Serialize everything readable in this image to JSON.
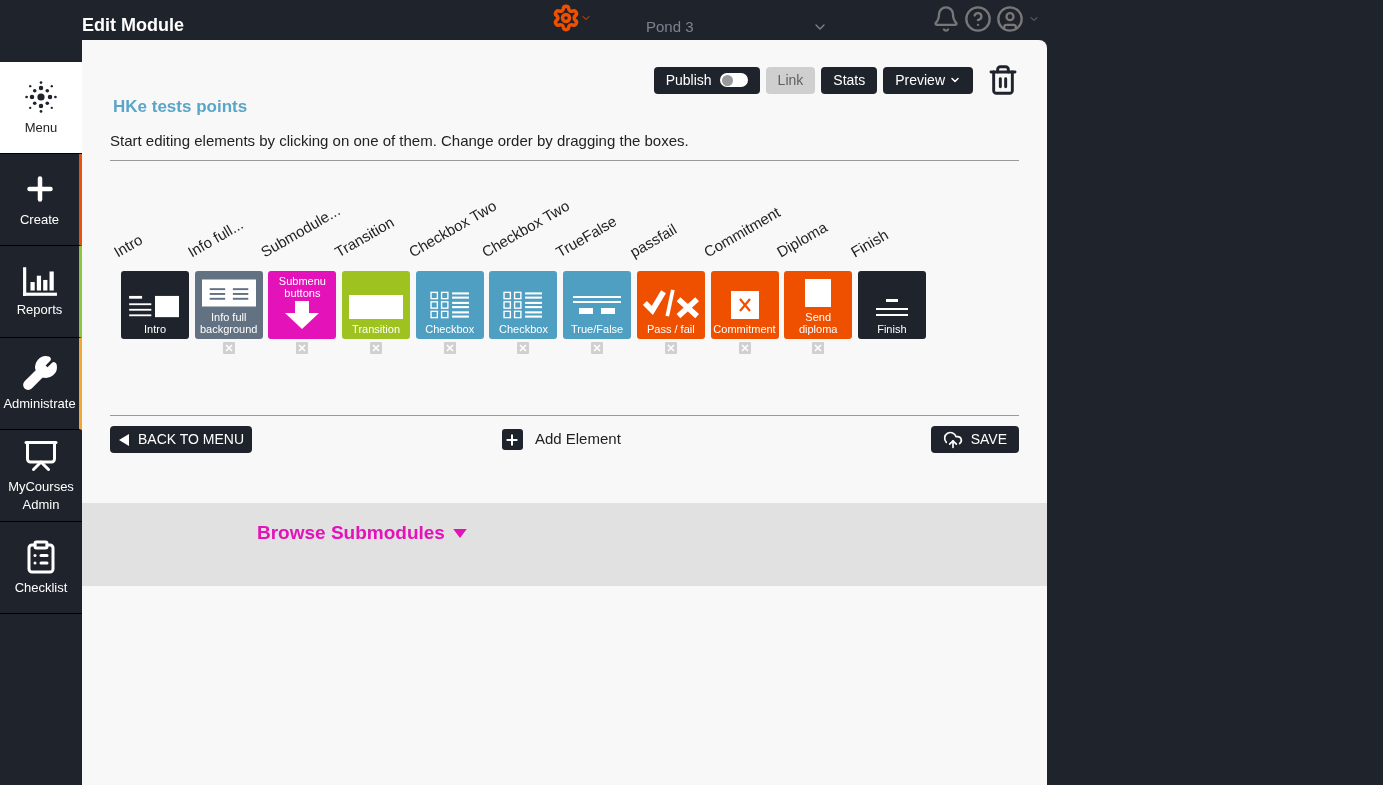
{
  "header": {
    "title": "Edit Module",
    "organization": "Pond 3"
  },
  "sidebar": {
    "items": [
      {
        "label": "Menu",
        "selected": true
      },
      {
        "label": "Create",
        "selected": false,
        "color": "#e8500c"
      },
      {
        "label": "Reports",
        "selected": false,
        "color": "#8cc63f"
      },
      {
        "label": "Administrate",
        "selected": false,
        "color": "#f0a830"
      },
      {
        "label": "MyCourses Admin",
        "selected": false
      },
      {
        "label": "Checklist",
        "selected": false
      }
    ]
  },
  "toolbar": {
    "publish": {
      "label": "Publish",
      "on": false
    },
    "link": {
      "label": "Link",
      "disabled": true
    },
    "stats": "Stats",
    "preview": "Preview"
  },
  "module": {
    "title": "HKe tests points",
    "instructions": "Start editing elements by clicking on one of them. Change order by dragging the boxes."
  },
  "elements": [
    {
      "name": "Intro",
      "tile": "Intro",
      "kind": "intro",
      "color": "#1f232b",
      "removable": false
    },
    {
      "name": "Info full...",
      "tile": "Info full background",
      "kind": "info",
      "color": "#637282",
      "removable": true
    },
    {
      "name": "Submodule...",
      "tile": "Submenu buttons",
      "kind": "submenu",
      "color": "#e312b9",
      "removable": true
    },
    {
      "name": "Transition",
      "tile": "Transition",
      "kind": "transition",
      "color": "#9ec21f",
      "removable": true
    },
    {
      "name": "Checkbox Two",
      "tile": "Checkbox",
      "kind": "checkbox",
      "color": "#4f9fc2",
      "removable": true
    },
    {
      "name": "Checkbox Two",
      "tile": "Checkbox",
      "kind": "checkbox",
      "color": "#4f9fc2",
      "removable": true
    },
    {
      "name": "TrueFalse",
      "tile": "True/False",
      "kind": "truefalse",
      "color": "#4f9fc2",
      "removable": true
    },
    {
      "name": "passfail",
      "tile": "Pass / fail",
      "kind": "passfail",
      "color": "#ee5000",
      "removable": true
    },
    {
      "name": "Commitment",
      "tile": "Commitment",
      "kind": "commitment",
      "color": "#ee5000",
      "removable": true
    },
    {
      "name": "Diploma",
      "tile": "Send diploma",
      "kind": "diploma",
      "color": "#ee5000",
      "removable": true
    },
    {
      "name": "Finish",
      "tile": "Finish",
      "kind": "finish",
      "color": "#1f232b",
      "removable": false
    }
  ],
  "actions": {
    "back": "BACK TO MENU",
    "add": "Add Element",
    "save": "SAVE"
  },
  "browse": {
    "label": "Browse Submodules"
  }
}
